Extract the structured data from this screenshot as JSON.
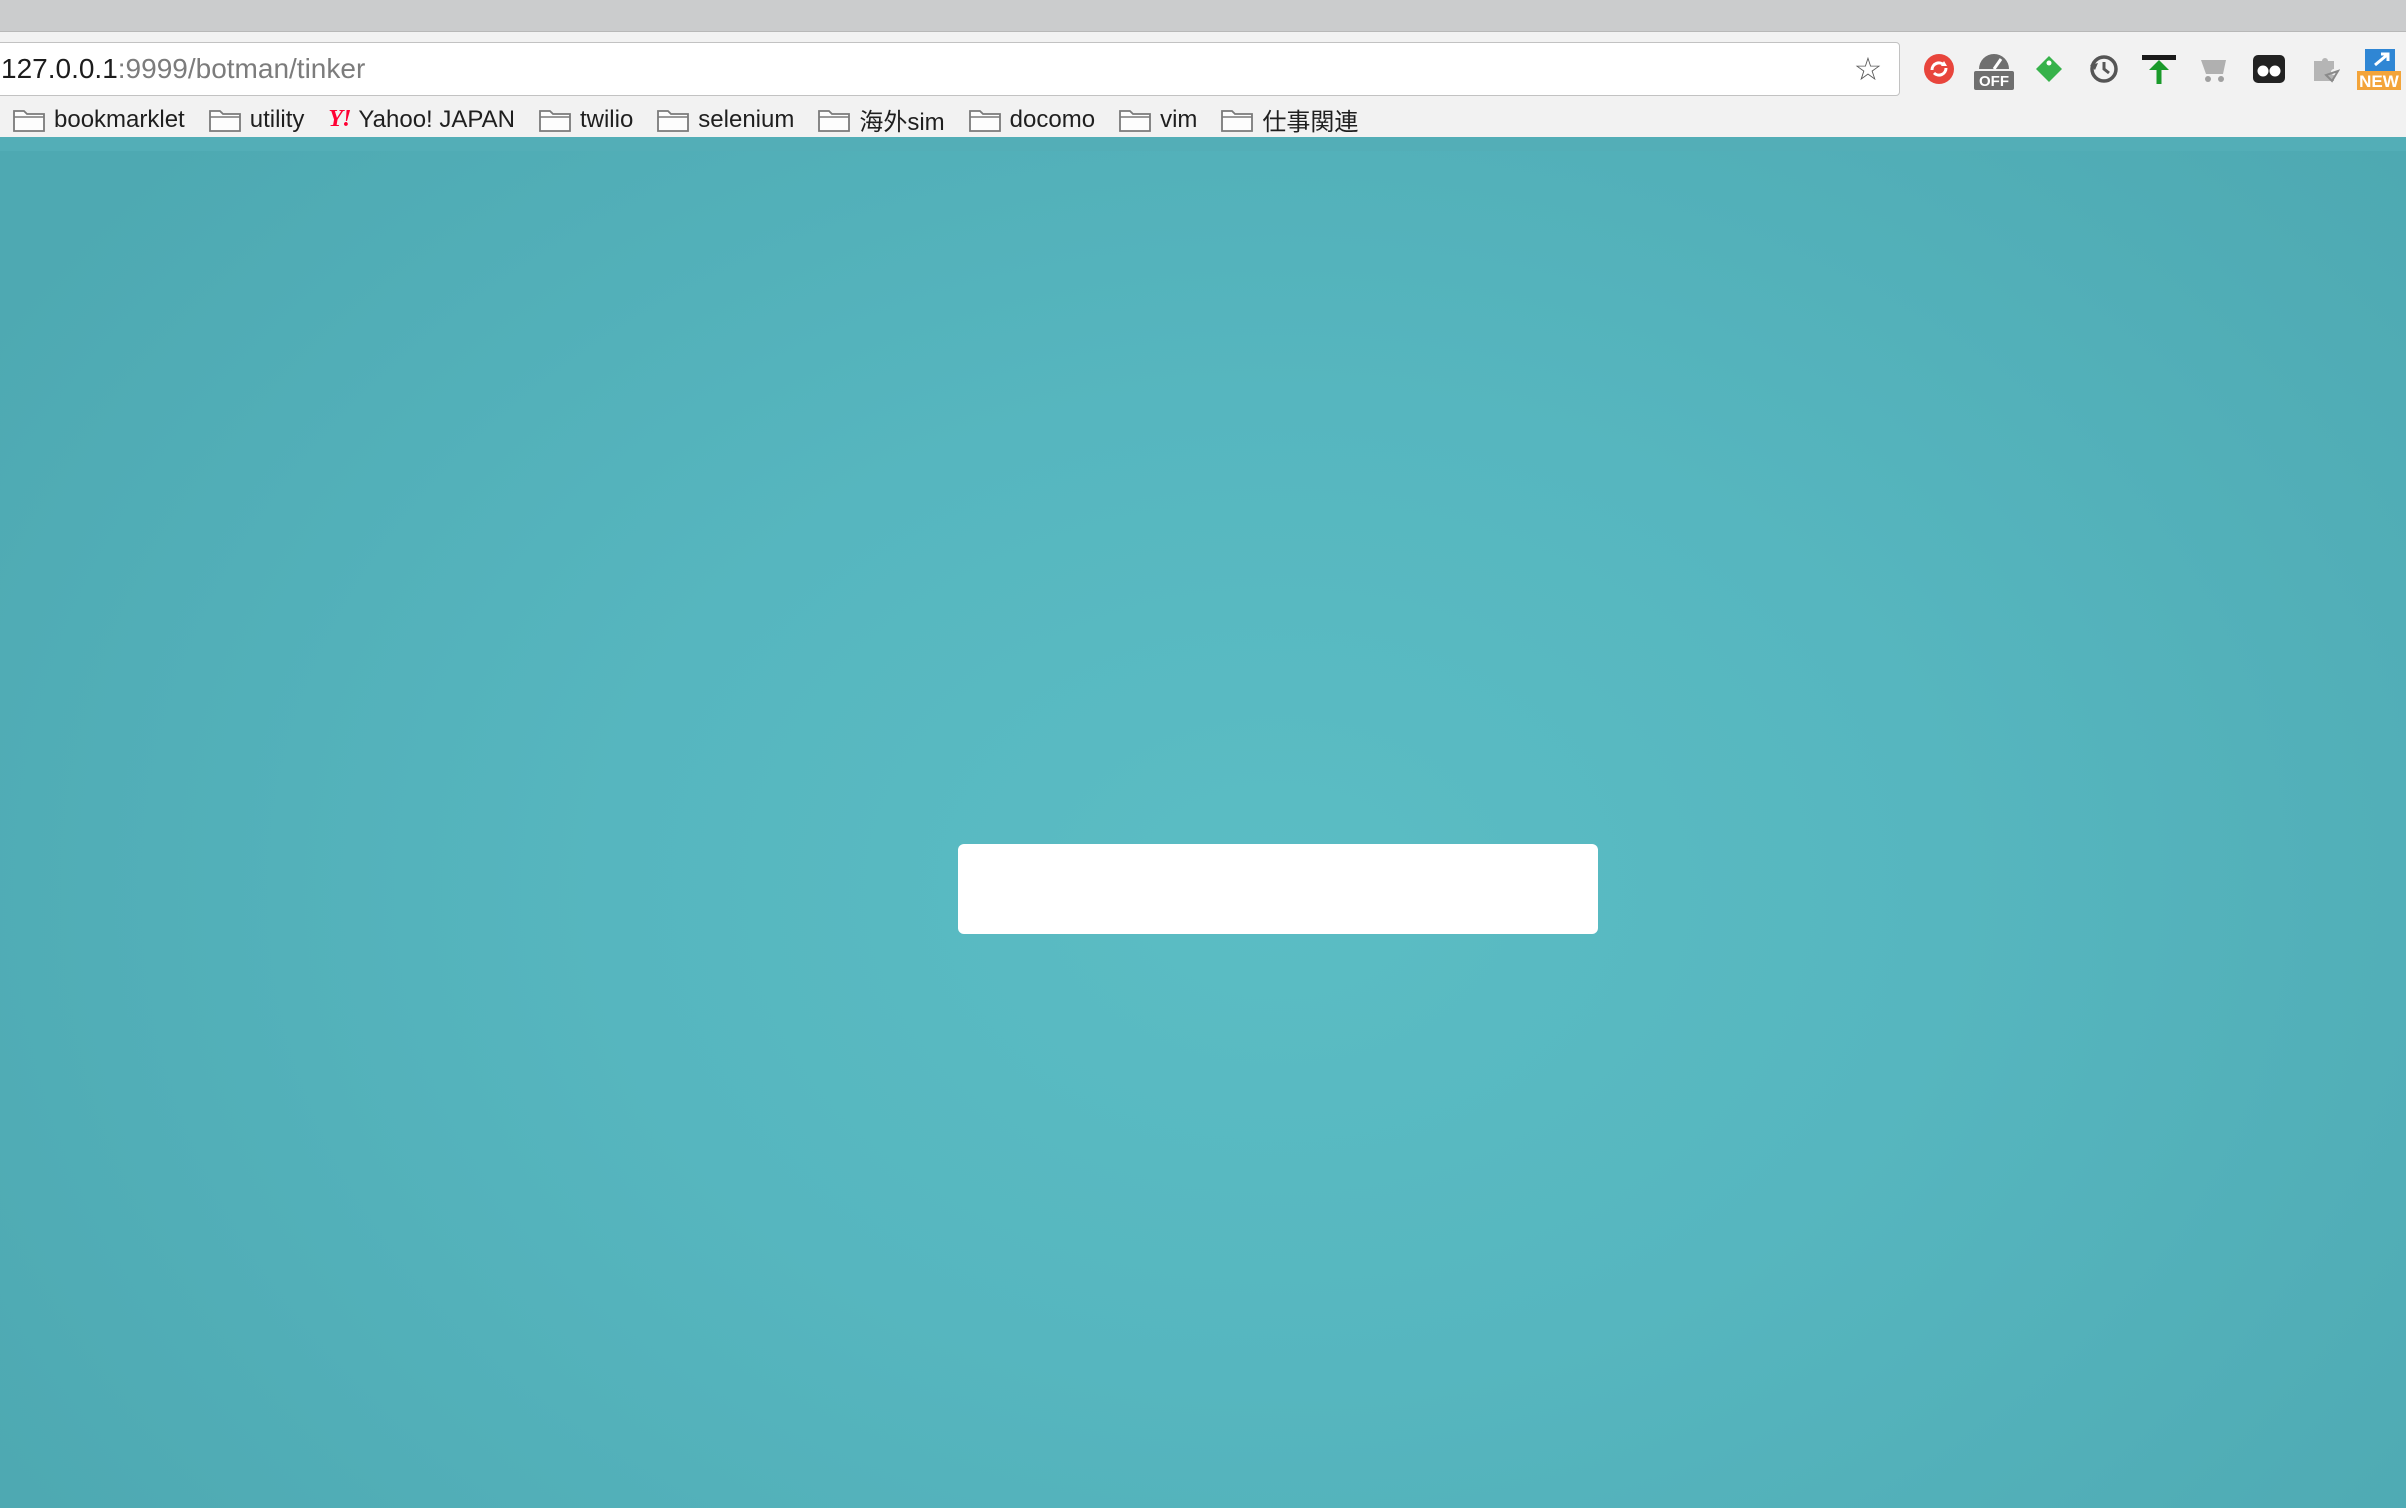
{
  "browser": {
    "url_host": "127.0.0.1",
    "url_rest": ":9999/botman/tinker",
    "bookmark_star_icon": "star-outline-icon",
    "extensions": [
      {
        "name": "red-refresh-extension-icon",
        "color": "#e8453c"
      },
      {
        "name": "gauge-off-extension-icon",
        "badge": "OFF",
        "color": "#6f6f6f"
      },
      {
        "name": "green-tag-extension-icon",
        "color": "#36b24a"
      },
      {
        "name": "clock-sync-extension-icon",
        "color": "#555555"
      },
      {
        "name": "green-upload-extension-icon",
        "color": "#1a9a2a"
      },
      {
        "name": "cart-extension-icon",
        "color": "#9c9c9c"
      },
      {
        "name": "glasses-extension-icon",
        "color": "#222222"
      },
      {
        "name": "puzzle-extension-icon",
        "color": "#9c9c9c"
      },
      {
        "name": "new-window-extension-icon",
        "badge": "NEW",
        "color": "#2f86d4"
      }
    ]
  },
  "bookmarks": [
    {
      "label": "bookmarklet",
      "icon": "folder-icon"
    },
    {
      "label": "utility",
      "icon": "folder-icon"
    },
    {
      "label": "Yahoo! JAPAN",
      "icon": "yahoo-logo-icon",
      "logo_text": "Y!"
    },
    {
      "label": "twilio",
      "icon": "folder-icon"
    },
    {
      "label": "selenium",
      "icon": "folder-icon"
    },
    {
      "label": "海外sim",
      "icon": "folder-icon"
    },
    {
      "label": "docomo",
      "icon": "folder-icon"
    },
    {
      "label": "vim",
      "icon": "folder-icon"
    },
    {
      "label": "仕事関連",
      "icon": "folder-icon"
    }
  ],
  "page": {
    "background_color": "#53aeb7",
    "chat_input": {
      "value": "",
      "placeholder": ""
    }
  }
}
